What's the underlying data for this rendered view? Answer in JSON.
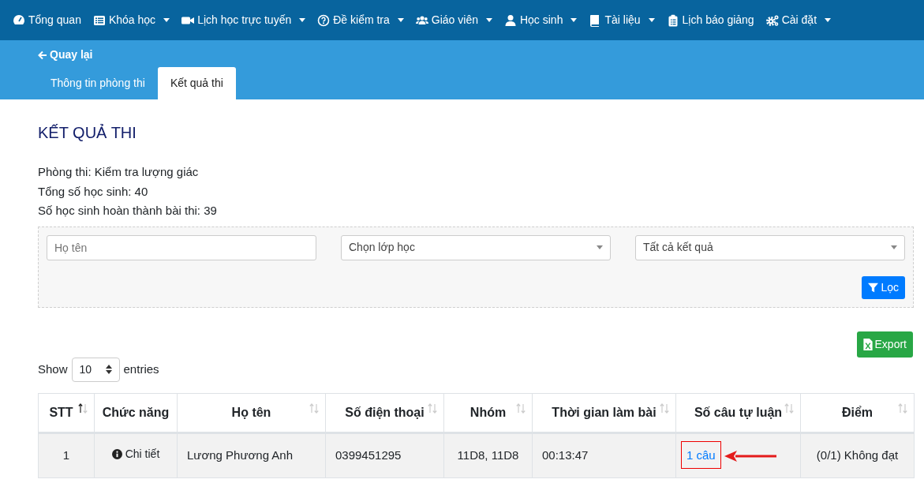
{
  "navbar": {
    "items": [
      {
        "label": "Tổng quan",
        "dropdown": false
      },
      {
        "label": "Khóa học",
        "dropdown": true
      },
      {
        "label": "Lịch học trực tuyến",
        "dropdown": true
      },
      {
        "label": "Đề kiểm tra",
        "dropdown": true
      },
      {
        "label": "Giáo viên",
        "dropdown": true
      },
      {
        "label": "Học sinh",
        "dropdown": true
      },
      {
        "label": "Tài liệu",
        "dropdown": true
      },
      {
        "label": "Lịch báo giảng",
        "dropdown": false
      },
      {
        "label": "Cài đặt",
        "dropdown": true
      }
    ]
  },
  "back_link": "Quay lại",
  "tabs": [
    {
      "label": "Thông tin phòng thi",
      "selected": false
    },
    {
      "label": "Kết quả thi",
      "selected": true
    }
  ],
  "page_title": "KẾT QUẢ THI",
  "info_lines": [
    "Phòng thi: Kiểm tra lượng giác",
    "Tổng số học sinh: 40",
    "Số học sinh hoàn thành bài thi: 39"
  ],
  "filters": {
    "fields": [
      {
        "kind": "input",
        "placeholder": "Họ tên"
      },
      {
        "kind": "select",
        "value": "Chọn lớp học"
      },
      {
        "kind": "select",
        "value": "Tất cả kết quả"
      }
    ],
    "button": "Lọc"
  },
  "export_button": "Export",
  "entries": {
    "before": "Show",
    "value": "10",
    "after": "entries"
  },
  "table": {
    "columns": [
      {
        "label": "STT",
        "sortable": true,
        "sorted": true
      },
      {
        "label": "Chức năng",
        "sortable": false
      },
      {
        "label": "Họ tên",
        "sortable": true,
        "sorted": false
      },
      {
        "label": "Số điện thoại",
        "sortable": true,
        "sorted": false
      },
      {
        "label": "Nhóm",
        "sortable": true,
        "sorted": false
      },
      {
        "label": "Thời gian làm bài",
        "sortable": true,
        "sorted": false
      },
      {
        "label": "Số câu tự luận",
        "sortable": true,
        "sorted": false
      },
      {
        "label": "Điểm",
        "sortable": true,
        "sorted": false
      }
    ],
    "rows": [
      {
        "cells": [
          {
            "kind": "text",
            "text": "1"
          },
          {
            "kind": "action",
            "text": "Chi tiết"
          },
          {
            "kind": "text",
            "text": "Lương Phương Anh"
          },
          {
            "kind": "text",
            "text": "0399451295"
          },
          {
            "kind": "text",
            "text": "11D8, 11D8"
          },
          {
            "kind": "text",
            "text": "00:13:47"
          },
          {
            "kind": "link",
            "text": "1 câu",
            "highlighted": true
          },
          {
            "kind": "text",
            "text": "(0/1) Không đạt"
          }
        ]
      }
    ]
  }
}
